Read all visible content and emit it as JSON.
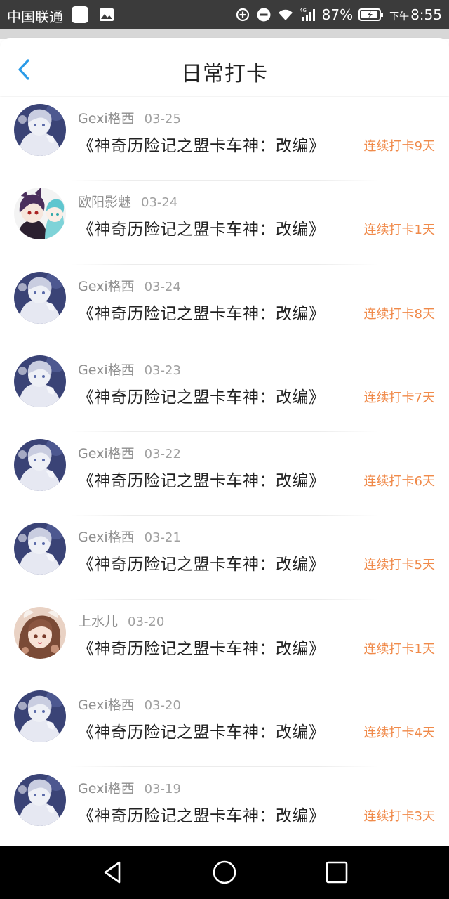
{
  "status_bar": {
    "carrier": "中国联通",
    "battery": "87%",
    "time_prefix": "下午",
    "time": "8:55",
    "network": "4G"
  },
  "header": {
    "title": "日常打卡",
    "back_icon": "chevron-left-icon"
  },
  "colors": {
    "accent": "#2a9be8",
    "streak": "#f08a4a",
    "name": "#8e8e8e"
  },
  "items": [
    {
      "name": "Gexi格西",
      "date": "03-25",
      "book": "《神奇历险记之盟卡车神：改编》",
      "streak": "连续打卡9天",
      "avatar": "gexi"
    },
    {
      "name": "欧阳影魅",
      "date": "03-24",
      "book": "《神奇历险记之盟卡车神：改编》",
      "streak": "连续打卡1天",
      "avatar": "ouyang"
    },
    {
      "name": "Gexi格西",
      "date": "03-24",
      "book": "《神奇历险记之盟卡车神：改编》",
      "streak": "连续打卡8天",
      "avatar": "gexi"
    },
    {
      "name": "Gexi格西",
      "date": "03-23",
      "book": "《神奇历险记之盟卡车神：改编》",
      "streak": "连续打卡7天",
      "avatar": "gexi"
    },
    {
      "name": "Gexi格西",
      "date": "03-22",
      "book": "《神奇历险记之盟卡车神：改编》",
      "streak": "连续打卡6天",
      "avatar": "gexi"
    },
    {
      "name": "Gexi格西",
      "date": "03-21",
      "book": "《神奇历险记之盟卡车神：改编》",
      "streak": "连续打卡5天",
      "avatar": "gexi"
    },
    {
      "name": "上水儿",
      "date": "03-20",
      "book": "《神奇历险记之盟卡车神：改编》",
      "streak": "连续打卡1天",
      "avatar": "shangshui"
    },
    {
      "name": "Gexi格西",
      "date": "03-20",
      "book": "《神奇历险记之盟卡车神：改编》",
      "streak": "连续打卡4天",
      "avatar": "gexi"
    },
    {
      "name": "Gexi格西",
      "date": "03-19",
      "book": "《神奇历险记之盟卡车神：改编》",
      "streak": "连续打卡3天",
      "avatar": "gexi"
    }
  ],
  "nav_bar": {
    "back": "back-triangle-icon",
    "home": "home-circle-icon",
    "recents": "recents-square-icon"
  }
}
